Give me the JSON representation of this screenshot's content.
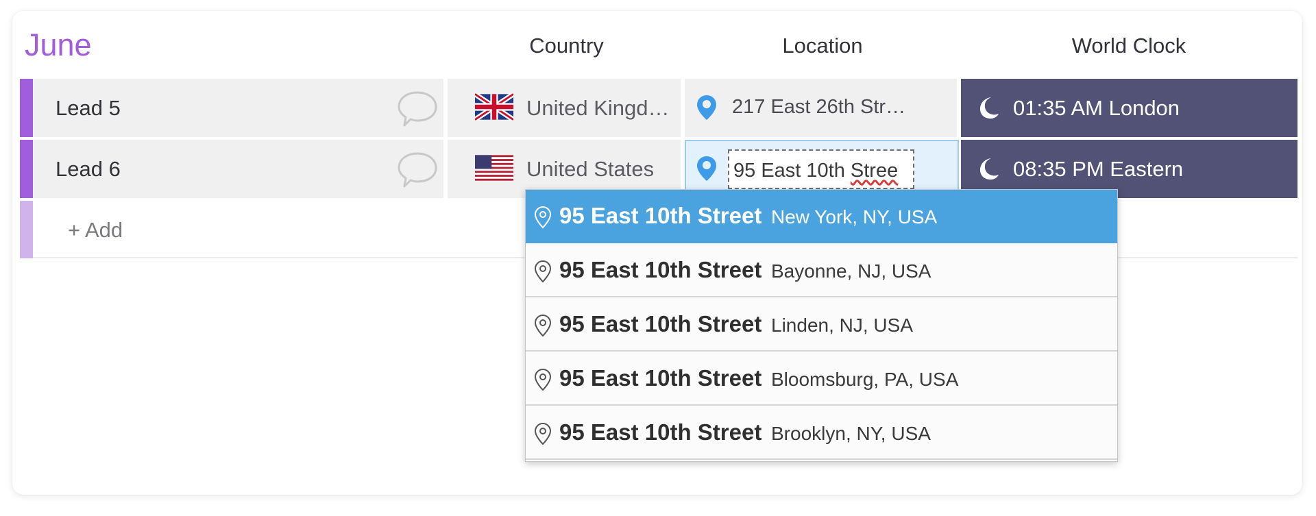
{
  "group": {
    "title": "June"
  },
  "columns": {
    "country": "Country",
    "location": "Location",
    "world_clock": "World Clock"
  },
  "rows": [
    {
      "name": "Lead 5",
      "country": "United Kingd…",
      "flag": "uk-flag-icon",
      "location": "217 East 26th Str…",
      "clock": "01:35 AM London",
      "clock_icon": "moon-icon"
    },
    {
      "name": "Lead 6",
      "country": "United States",
      "flag": "us-flag-icon",
      "location_input_before": "95 East 10th ",
      "location_input_misspelled": "Stree",
      "clock": "08:35 PM Eastern",
      "clock_icon": "moon-icon"
    }
  ],
  "add_row": {
    "label": "+ Add"
  },
  "dropdown": {
    "items": [
      {
        "main": "95 East 10th Street",
        "sub": "New York, NY, USA",
        "selected": true
      },
      {
        "main": "95 East 10th Street",
        "sub": "Bayonne, NJ, USA",
        "selected": false
      },
      {
        "main": "95 East 10th Street",
        "sub": "Linden, NJ, USA",
        "selected": false
      },
      {
        "main": "95 East 10th Street",
        "sub": "Bloomsburg, PA, USA",
        "selected": false
      },
      {
        "main": "95 East 10th Street",
        "sub": "Brooklyn, NY, USA",
        "selected": false
      }
    ]
  },
  "colors": {
    "group_accent": "#a25ddc",
    "add_bar": "#d0b3ec",
    "clock_bg": "#515275",
    "pin_blue": "#3d9be9",
    "selected_item": "#4aa3df"
  }
}
